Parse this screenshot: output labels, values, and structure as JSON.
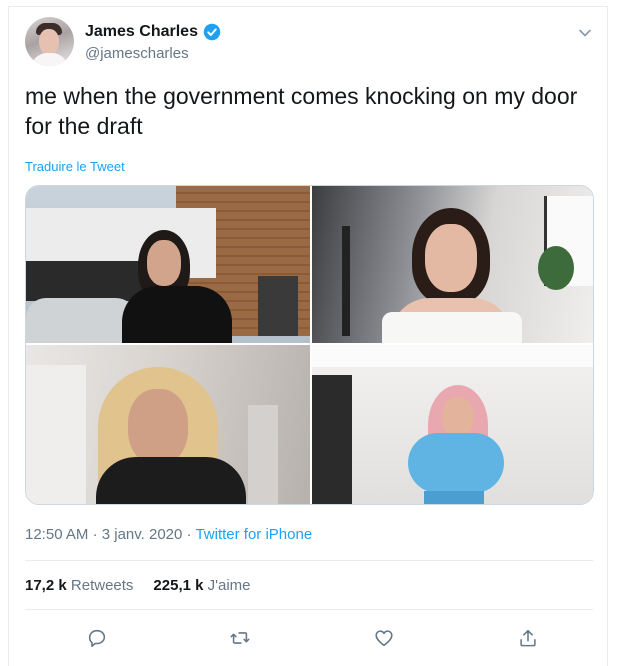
{
  "author": {
    "name": "James Charles",
    "handle": "@jamescharles"
  },
  "tweet": {
    "text": "me when the government comes knocking on my door for the draft",
    "translate_label": "Traduire le Tweet"
  },
  "meta": {
    "time": "12:50 AM",
    "separator": "·",
    "date": "3 janv. 2020",
    "source": "Twitter for iPhone"
  },
  "stats": {
    "retweets_count": "17,2 k",
    "retweets_label": "Retweets",
    "likes_count": "225,1 k",
    "likes_label": "J'aime"
  },
  "icons": [
    "verified-icon",
    "chevron-down-icon",
    "reply-icon",
    "retweet-icon",
    "like-icon",
    "share-icon"
  ],
  "colors": {
    "accent": "#1da1f2",
    "secondary_text": "#657786",
    "primary_text": "#14171a"
  }
}
